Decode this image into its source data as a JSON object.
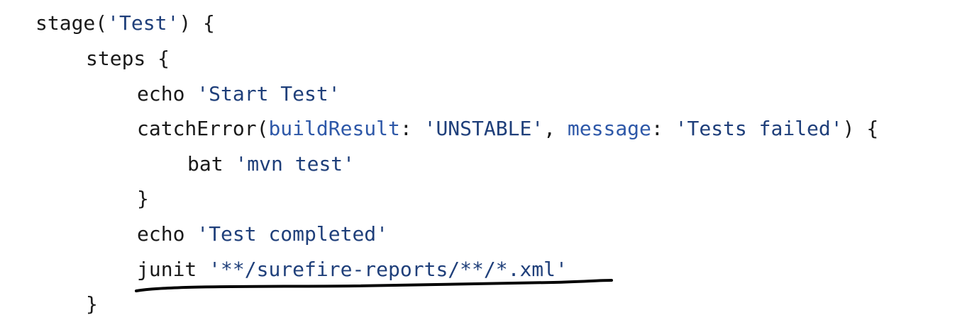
{
  "code": {
    "lines": [
      [
        {
          "t": "stage(",
          "k": "plain"
        },
        {
          "t": "'Test'",
          "k": "string"
        },
        {
          "t": ") {",
          "k": "plain"
        }
      ],
      [
        {
          "t": "steps {",
          "k": "plain"
        }
      ],
      [
        {
          "t": "echo ",
          "k": "plain"
        },
        {
          "t": "'Start Test'",
          "k": "string"
        }
      ],
      [
        {
          "t": "catchError(",
          "k": "plain"
        },
        {
          "t": "buildResult",
          "k": "param"
        },
        {
          "t": ": ",
          "k": "plain"
        },
        {
          "t": "'UNSTABLE'",
          "k": "string"
        },
        {
          "t": ", ",
          "k": "plain"
        },
        {
          "t": "message",
          "k": "param"
        },
        {
          "t": ": ",
          "k": "plain"
        },
        {
          "t": "'Tests failed'",
          "k": "string"
        },
        {
          "t": ") {",
          "k": "plain"
        }
      ],
      [
        {
          "t": "bat ",
          "k": "plain"
        },
        {
          "t": "'mvn test'",
          "k": "string"
        }
      ],
      [
        {
          "t": "}",
          "k": "plain"
        }
      ],
      [
        {
          "t": "echo ",
          "k": "plain"
        },
        {
          "t": "'Test completed'",
          "k": "string"
        }
      ],
      [
        {
          "t": "junit ",
          "k": "plain"
        },
        {
          "t": "'**/surefire-reports/**/*.xml'",
          "k": "string"
        }
      ],
      [
        {
          "t": "}",
          "k": "plain"
        }
      ]
    ]
  },
  "colors": {
    "text": "#1a1a1a",
    "string": "#1f3f7a",
    "param": "#2e58a8",
    "annotation": "#000000"
  }
}
